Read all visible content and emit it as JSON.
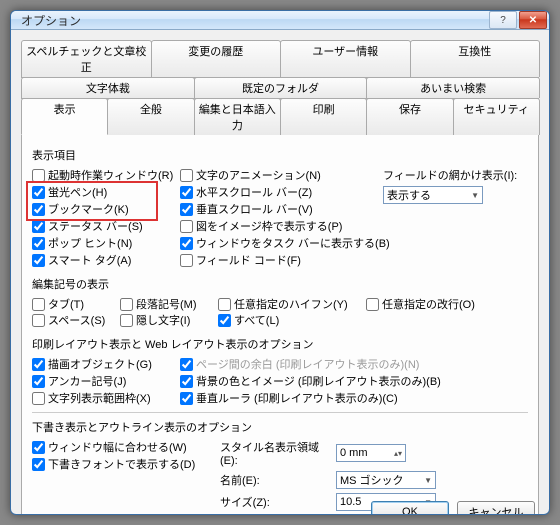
{
  "window": {
    "title": "オプション"
  },
  "tabs_row1": [
    "スペルチェックと文章校正",
    "変更の履歴",
    "ユーザー情報",
    "互換性"
  ],
  "tabs_row2": [
    "文字体裁",
    "既定のフォルダ",
    "あいまい検索"
  ],
  "tabs_row3": [
    "表示",
    "全般",
    "編集と日本語入力",
    "印刷",
    "保存",
    "セキュリティ"
  ],
  "active_tab": "表示",
  "section1": {
    "label": "表示項目",
    "col1": [
      {
        "label": "起動時作業ウィンドウ(R)",
        "checked": false
      },
      {
        "label": "蛍光ペン(H)",
        "checked": true
      },
      {
        "label": "ブックマーク(K)",
        "checked": true
      },
      {
        "label": "ステータス バー(S)",
        "checked": true
      },
      {
        "label": "ポップ ヒント(N)",
        "checked": true
      },
      {
        "label": "スマート タグ(A)",
        "checked": true
      }
    ],
    "col2": [
      {
        "label": "文字のアニメーション(N)",
        "checked": false
      },
      {
        "label": "水平スクロール バー(Z)",
        "checked": true
      },
      {
        "label": "垂直スクロール バー(V)",
        "checked": true
      },
      {
        "label": "図をイメージ枠で表示する(P)",
        "checked": false
      },
      {
        "label": "ウィンドウをタスク バーに表示する(B)",
        "checked": true
      },
      {
        "label": "フィールド コード(F)",
        "checked": false
      }
    ],
    "col3_label": "フィールドの網かけ表示(I):",
    "col3_value": "表示する"
  },
  "section2": {
    "label": "編集記号の表示",
    "row1": [
      {
        "label": "タブ(T)",
        "checked": false
      },
      {
        "label": "段落記号(M)",
        "checked": false
      },
      {
        "label": "任意指定のハイフン(Y)",
        "checked": false
      },
      {
        "label": "任意指定の改行(O)",
        "checked": false
      }
    ],
    "row2": [
      {
        "label": "スペース(S)",
        "checked": false
      },
      {
        "label": "隠し文字(I)",
        "checked": false
      },
      {
        "label": "すべて(L)",
        "checked": true
      }
    ]
  },
  "section3": {
    "label": "印刷レイアウト表示と Web レイアウト表示のオプション",
    "col1": [
      {
        "label": "描画オブジェクト(G)",
        "checked": true
      },
      {
        "label": "アンカー記号(J)",
        "checked": true
      },
      {
        "label": "文字列表示範囲枠(X)",
        "checked": false
      }
    ],
    "col2": [
      {
        "label": "ページ間の余白 (印刷レイアウト表示のみ)(N)",
        "checked": true,
        "disabled": true
      },
      {
        "label": "背景の色とイメージ (印刷レイアウト表示のみ)(B)",
        "checked": true
      },
      {
        "label": "垂直ルーラ (印刷レイアウト表示のみ)(C)",
        "checked": true
      }
    ]
  },
  "section4": {
    "label": "下書き表示とアウトライン表示のオプション",
    "left": [
      {
        "label": "ウィンドウ幅に合わせる(W)",
        "checked": true
      },
      {
        "label": "下書きフォントで表示する(D)",
        "checked": true
      }
    ],
    "rows": [
      {
        "label": "スタイル名表示領域(E):",
        "type": "spin",
        "value": "0 mm"
      },
      {
        "label": "名前(E):",
        "type": "combo",
        "value": "MS ゴシック"
      },
      {
        "label": "サイズ(Z):",
        "type": "combo",
        "value": "10.5"
      }
    ]
  },
  "buttons": {
    "ok": "OK",
    "cancel": "キャンセル"
  }
}
